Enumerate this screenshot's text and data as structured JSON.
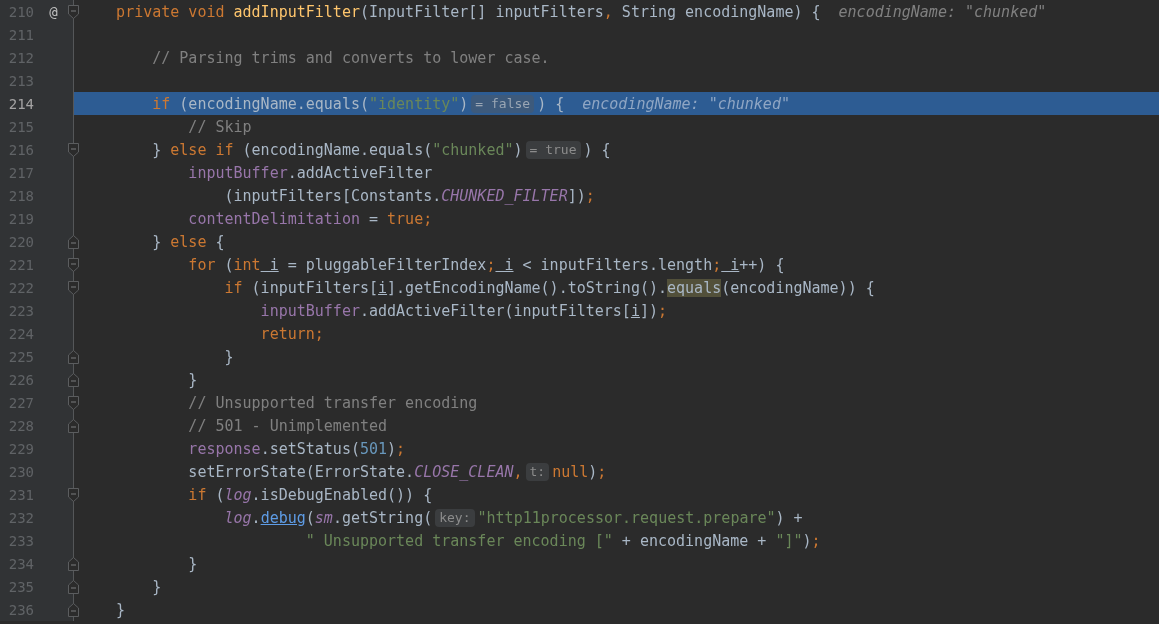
{
  "lines": [
    {
      "number": "210",
      "selected": false,
      "gutter_icon": "@",
      "fold": {
        "kind": "start"
      },
      "segments": [
        {
          "kind": "code",
          "tokens": [
            {
              "text": "    private void",
              "kind": "kw"
            },
            {
              "text": " addInputFilter",
              "kind": "fn"
            },
            {
              "text": "(InputFilter[] inputFilters"
            },
            {
              "text": ",",
              "kind": "kw"
            },
            {
              "text": " String encodingName) {"
            }
          ]
        },
        {
          "kind": "value",
          "text": "encodingName: \"chunked\""
        }
      ]
    },
    {
      "number": "211",
      "selected": false
    },
    {
      "number": "212",
      "selected": false,
      "segments": [
        {
          "kind": "code",
          "tokens": [
            {
              "text": "        // Parsing trims and converts to lower case.",
              "kind": "cmt"
            }
          ]
        }
      ]
    },
    {
      "number": "213",
      "selected": false
    },
    {
      "number": "214",
      "selected": true,
      "segments": [
        {
          "kind": "code",
          "tokens": [
            {
              "text": "        if",
              "kind": "kw"
            },
            {
              "text": " (encodingName.equals("
            },
            {
              "text": "\"identity\"",
              "kind": "str"
            },
            {
              "text": ")"
            }
          ]
        },
        {
          "kind": "hint",
          "text": "= false"
        },
        {
          "kind": "code",
          "tokens": [
            {
              "text": ") {"
            }
          ]
        },
        {
          "kind": "value",
          "text": "encodingName: \"chunked\""
        }
      ]
    },
    {
      "number": "215",
      "selected": false,
      "segments": [
        {
          "kind": "code",
          "tokens": [
            {
              "text": "            // Skip",
              "kind": "cmt"
            }
          ]
        }
      ]
    },
    {
      "number": "216",
      "selected": false,
      "fold": {
        "kind": "start"
      },
      "segments": [
        {
          "kind": "code",
          "tokens": [
            {
              "text": "        }"
            },
            {
              "text": " else if",
              "kind": "kw"
            },
            {
              "text": " (encodingName.equals("
            },
            {
              "text": "\"chunked\"",
              "kind": "str"
            },
            {
              "text": ")"
            }
          ]
        },
        {
          "kind": "hint",
          "text": "= true"
        },
        {
          "kind": "code",
          "tokens": [
            {
              "text": ") {"
            }
          ]
        }
      ]
    },
    {
      "number": "217",
      "selected": false,
      "segments": [
        {
          "kind": "code",
          "tokens": [
            {
              "text": "            inputBuffer",
              "kind": "field"
            },
            {
              "text": ".addActiveFilter"
            }
          ]
        }
      ]
    },
    {
      "number": "218",
      "selected": false,
      "segments": [
        {
          "kind": "code",
          "tokens": [
            {
              "text": "                (inputFilters[Constants."
            },
            {
              "text": "CHUNKED_FILTER",
              "kind": "static"
            },
            {
              "text": "])"
            },
            {
              "text": ";",
              "kind": "kw"
            }
          ]
        }
      ]
    },
    {
      "number": "219",
      "selected": false,
      "segments": [
        {
          "kind": "code",
          "tokens": [
            {
              "text": "            contentDelimitation",
              "kind": "field"
            },
            {
              "text": " = "
            },
            {
              "text": "true;",
              "kind": "kw"
            }
          ]
        }
      ]
    },
    {
      "number": "220",
      "selected": false,
      "fold": {
        "kind": "end"
      },
      "segments": [
        {
          "kind": "code",
          "tokens": [
            {
              "text": "        }"
            },
            {
              "text": " else",
              "kind": "kw"
            },
            {
              "text": " {"
            }
          ]
        }
      ]
    },
    {
      "number": "221",
      "selected": false,
      "fold": {
        "kind": "start"
      },
      "segments": [
        {
          "kind": "code",
          "tokens": [
            {
              "text": "            for",
              "kind": "kw"
            },
            {
              "text": " ("
            },
            {
              "text": "int",
              "kind": "kw"
            },
            {
              "text": " i",
              "kind": "under"
            },
            {
              "text": " = pluggableFilterIndex"
            },
            {
              "text": ";",
              "kind": "kw"
            },
            {
              "text": " i",
              "kind": "under"
            },
            {
              "text": " < inputFilters.length"
            },
            {
              "text": ";",
              "kind": "kw"
            },
            {
              "text": " i",
              "kind": "under"
            },
            {
              "text": "++) {"
            }
          ]
        }
      ]
    },
    {
      "number": "222",
      "selected": false,
      "fold": {
        "kind": "start"
      },
      "segments": [
        {
          "kind": "code",
          "tokens": [
            {
              "text": "                if",
              "kind": "kw"
            },
            {
              "text": " (inputFilters["
            },
            {
              "text": "i",
              "kind": "under"
            },
            {
              "text": "].getEncodingName().toString()."
            },
            {
              "text": "equals",
              "kind": "match"
            },
            {
              "text": "(encodingName)) {"
            }
          ]
        }
      ]
    },
    {
      "number": "223",
      "selected": false,
      "segments": [
        {
          "kind": "code",
          "tokens": [
            {
              "text": "                    inputBuffer",
              "kind": "field"
            },
            {
              "text": ".addActiveFilter(inputFilters["
            },
            {
              "text": "i",
              "kind": "under"
            },
            {
              "text": "])"
            },
            {
              "text": ";",
              "kind": "kw"
            }
          ]
        }
      ]
    },
    {
      "number": "224",
      "selected": false,
      "segments": [
        {
          "kind": "code",
          "tokens": [
            {
              "text": "                    return;",
              "kind": "kw"
            }
          ]
        }
      ]
    },
    {
      "number": "225",
      "selected": false,
      "fold": {
        "kind": "end"
      },
      "segments": [
        {
          "kind": "code",
          "tokens": [
            {
              "text": "                }"
            }
          ]
        }
      ]
    },
    {
      "number": "226",
      "selected": false,
      "fold": {
        "kind": "end"
      },
      "segments": [
        {
          "kind": "code",
          "tokens": [
            {
              "text": "            }"
            }
          ]
        }
      ]
    },
    {
      "number": "227",
      "selected": false,
      "fold": {
        "kind": "start"
      },
      "segments": [
        {
          "kind": "code",
          "tokens": [
            {
              "text": "            // Unsupported transfer encoding",
              "kind": "cmt"
            }
          ]
        }
      ]
    },
    {
      "number": "228",
      "selected": false,
      "fold": {
        "kind": "end"
      },
      "segments": [
        {
          "kind": "code",
          "tokens": [
            {
              "text": "            // 501 - Unimplemented",
              "kind": "cmt"
            }
          ]
        }
      ]
    },
    {
      "number": "229",
      "selected": false,
      "segments": [
        {
          "kind": "code",
          "tokens": [
            {
              "text": "            response",
              "kind": "field"
            },
            {
              "text": ".setStatus("
            },
            {
              "text": "501",
              "kind": "num"
            },
            {
              "text": ")"
            },
            {
              "text": ";",
              "kind": "kw"
            }
          ]
        }
      ]
    },
    {
      "number": "230",
      "selected": false,
      "segments": [
        {
          "kind": "code",
          "tokens": [
            {
              "text": "            setErrorState(ErrorState."
            },
            {
              "text": "CLOSE_CLEAN",
              "kind": "static"
            },
            {
              "text": ",",
              "kind": "kw"
            }
          ]
        },
        {
          "kind": "hint",
          "text": "t:"
        },
        {
          "kind": "code",
          "tokens": [
            {
              "text": "null",
              "kind": "kw"
            },
            {
              "text": ")"
            },
            {
              "text": ";",
              "kind": "kw"
            }
          ]
        }
      ]
    },
    {
      "number": "231",
      "selected": false,
      "fold": {
        "kind": "start"
      },
      "segments": [
        {
          "kind": "code",
          "tokens": [
            {
              "text": "            if",
              "kind": "kw"
            },
            {
              "text": " ("
            },
            {
              "text": "log",
              "kind": "static"
            },
            {
              "text": ".isDebugEnabled()) {"
            }
          ]
        }
      ]
    },
    {
      "number": "232",
      "selected": false,
      "segments": [
        {
          "kind": "code",
          "tokens": [
            {
              "text": "                log",
              "kind": "static"
            },
            {
              "text": "."
            },
            {
              "text": "debug",
              "kind": "link"
            },
            {
              "text": "("
            },
            {
              "text": "sm",
              "kind": "static"
            },
            {
              "text": ".getString("
            }
          ]
        },
        {
          "kind": "hint",
          "text": "key:"
        },
        {
          "kind": "code",
          "tokens": [
            {
              "text": "\"http11processor.request.prepare\"",
              "kind": "str"
            },
            {
              "text": ") +"
            }
          ]
        }
      ]
    },
    {
      "number": "233",
      "selected": false,
      "segments": [
        {
          "kind": "code",
          "tokens": [
            {
              "text": "                         \" Unsupported transfer encoding [\"",
              "kind": "str"
            },
            {
              "text": " + encodingName + "
            },
            {
              "text": "\"]\"",
              "kind": "str"
            },
            {
              "text": ")"
            },
            {
              "text": ";",
              "kind": "kw"
            }
          ]
        }
      ]
    },
    {
      "number": "234",
      "selected": false,
      "fold": {
        "kind": "end"
      },
      "segments": [
        {
          "kind": "code",
          "tokens": [
            {
              "text": "            }"
            }
          ]
        }
      ]
    },
    {
      "number": "235",
      "selected": false,
      "fold": {
        "kind": "end"
      },
      "segments": [
        {
          "kind": "code",
          "tokens": [
            {
              "text": "        }"
            }
          ]
        }
      ]
    },
    {
      "number": "236",
      "selected": false,
      "fold": {
        "kind": "end"
      },
      "segments": [
        {
          "kind": "code",
          "tokens": [
            {
              "text": "    }"
            }
          ]
        }
      ]
    }
  ]
}
